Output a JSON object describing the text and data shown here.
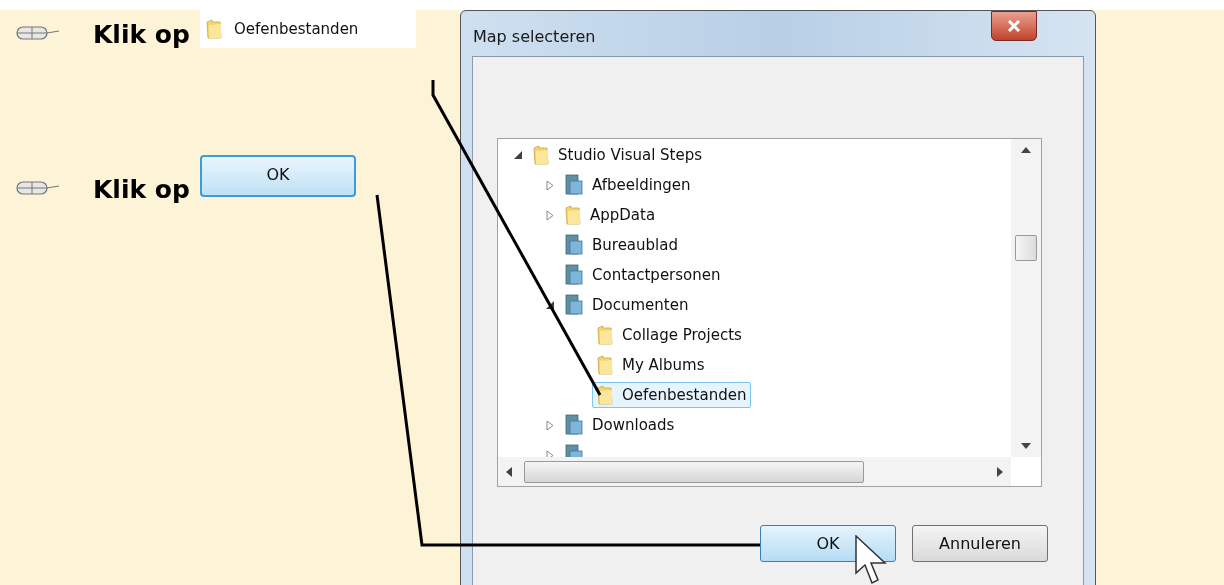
{
  "steps": [
    {
      "text": "Klik op",
      "target": {
        "kind": "folder-chip",
        "label": "Oefenbestanden"
      }
    },
    {
      "text": "Klik op",
      "target": {
        "kind": "button",
        "label": "OK"
      }
    }
  ],
  "dialog": {
    "title": "Map selecteren",
    "tree": [
      {
        "label": "Studio Visual Steps",
        "kind": "folder",
        "expanded": true,
        "selected": false,
        "children": [
          {
            "label": "Afbeeldingen",
            "kind": "library",
            "expanded": false,
            "selected": false
          },
          {
            "label": "AppData",
            "kind": "folder",
            "expanded": false,
            "selected": false
          },
          {
            "label": "Bureaublad",
            "kind": "library",
            "selected": false
          },
          {
            "label": "Contactpersonen",
            "kind": "library",
            "selected": false
          },
          {
            "label": "Documenten",
            "kind": "library",
            "expanded": true,
            "selected": false,
            "children": [
              {
                "label": "Collage Projects",
                "kind": "folder",
                "selected": false
              },
              {
                "label": "My Albums",
                "kind": "folder",
                "selected": false
              },
              {
                "label": "Oefenbestanden",
                "kind": "folder",
                "selected": true
              }
            ]
          },
          {
            "label": "Downloads",
            "kind": "library",
            "expanded": false,
            "selected": false
          },
          {
            "kind": "library",
            "expanded": false,
            "selected": false
          }
        ]
      }
    ],
    "buttons": [
      {
        "label": "OK",
        "default": true
      },
      {
        "label": "Annuleren",
        "default": false
      }
    ]
  }
}
